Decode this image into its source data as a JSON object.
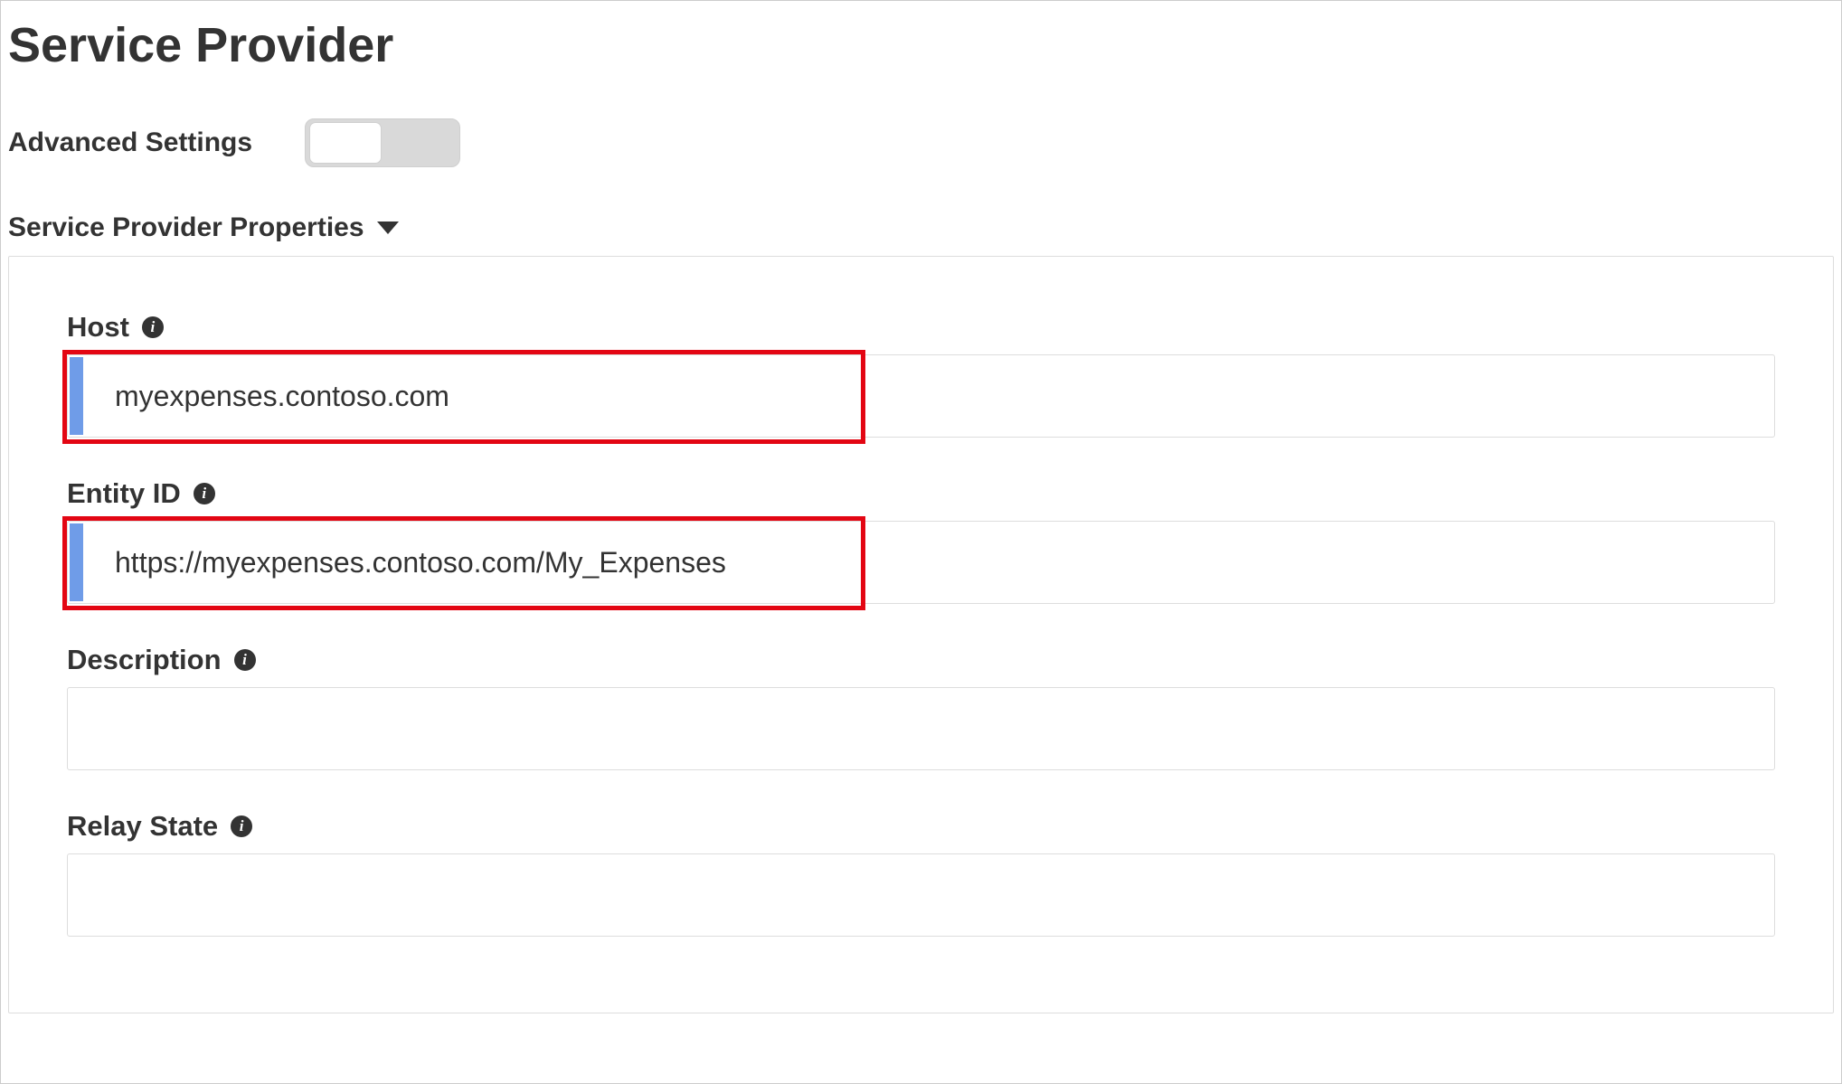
{
  "page": {
    "title": "Service Provider"
  },
  "advanced": {
    "label": "Advanced Settings",
    "toggle_state": "off"
  },
  "section": {
    "title": "Service Provider Properties"
  },
  "fields": {
    "host": {
      "label": "Host",
      "value": "myexpenses.contoso.com"
    },
    "entity_id": {
      "label": "Entity ID",
      "value": "https://myexpenses.contoso.com/My_Expenses"
    },
    "description": {
      "label": "Description",
      "value": ""
    },
    "relay_state": {
      "label": "Relay State",
      "value": ""
    }
  },
  "info_glyph": "i"
}
